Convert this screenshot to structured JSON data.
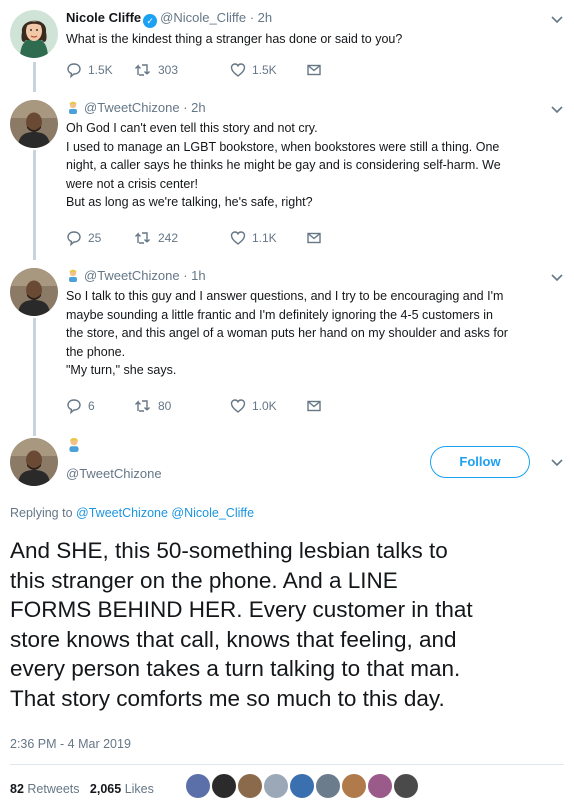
{
  "tweet1": {
    "name": "Nicole Cliffe",
    "handle": "@Nicole_Cliffe",
    "time": "· 2h",
    "text": "What is the kindest thing a stranger has done or said to you?",
    "replies": "1.5K",
    "retweets": "303",
    "likes": "1.5K",
    "avatar_icon": "woman-illustration-avatar"
  },
  "tweet2": {
    "handle": "@TweetChizone",
    "time": "· 2h",
    "lines": [
      "Oh God I can't even tell this story and not cry.",
      "I used to manage an LGBT bookstore, when bookstores were still a thing. One",
      "night, a caller says he thinks he might be gay and is considering self-harm. We",
      "were not a crisis center!",
      "But as long as we're talking, he's safe, right?"
    ],
    "replies": "25",
    "retweets": "242",
    "likes": "1.1K"
  },
  "tweet3": {
    "handle": "@TweetChizone",
    "time": "· 1h",
    "lines": [
      "So I talk to this guy and I answer questions, and I try to be encouraging and I'm",
      "maybe sounding a little frantic and I'm definitely ignoring the 4-5 customers in",
      "the store, and this angel of a woman puts her hand on my shoulder and asks for",
      "the phone.",
      "\"My turn,\" she says."
    ],
    "replies": "6",
    "retweets": "80",
    "likes": "1.0K"
  },
  "main": {
    "handle": "@TweetChizone",
    "follow_label": "Follow",
    "replying_prefix": "Replying to",
    "replying_to_1": "@TweetChizone",
    "replying_to_2": "@Nicole_Cliffe",
    "lines": [
      "And SHE, this 50-something lesbian talks to",
      "this stranger on the phone. And a LINE",
      "FORMS BEHIND HER. Every customer in that",
      "store knows that call, knows that feeling, and",
      "every person takes a turn talking to that man.",
      "That story comforts me so much to this day."
    ],
    "timestamp": "2:36 PM - 4 Mar 2019",
    "retweets_count": "82",
    "retweets_label": "Retweets",
    "likes_count": "2,065",
    "likes_label": "Likes"
  },
  "colors": {
    "link": "#1b95e0",
    "accent": "#1da1f2",
    "muted": "#657786",
    "text": "#14171a"
  },
  "liker_colors": [
    "#5b6fa8",
    "#2b2b2b",
    "#8a6a4a",
    "#9aa8b8",
    "#3a6fb0",
    "#6b7d8c",
    "#b07a4a",
    "#9a5a8a",
    "#4a4a4a"
  ]
}
